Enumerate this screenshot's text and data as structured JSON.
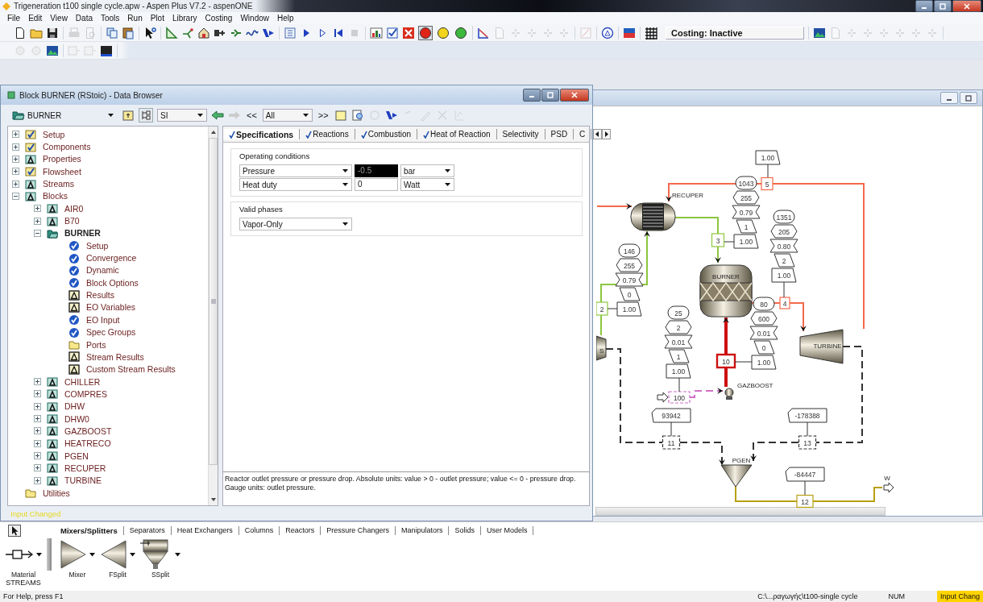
{
  "window": {
    "title": "Trigeneration t100 single cycle.apw - Aspen Plus V7.2 - aspenONE"
  },
  "menu": [
    "File",
    "Edit",
    "View",
    "Data",
    "Tools",
    "Run",
    "Plot",
    "Library",
    "Costing",
    "Window",
    "Help"
  ],
  "toolbar_1": {
    "groups": [
      [
        {
          "disabled": false
        },
        {
          "disabled": false
        },
        {
          "disabled": false
        }
      ],
      [
        {
          "disabled": true
        },
        {
          "disabled": true
        }
      ],
      [
        {
          "disabled": false
        },
        {
          "disabled": false
        }
      ],
      [
        {
          "disabled": false
        }
      ],
      [
        {
          "disabled": false
        },
        {
          "disabled": false
        },
        {
          "disabled": false
        },
        {
          "disabled": false
        },
        {
          "disabled": false
        },
        {
          "disabled": false
        },
        {
          "disabled": false
        }
      ],
      [
        {
          "disabled": false
        },
        {
          "disabled": false
        },
        {
          "disabled": false
        },
        {
          "disabled": false
        },
        {
          "disabled": true
        }
      ],
      [
        {
          "disabled": false
        },
        {
          "disabled": false
        },
        {
          "disabled": false
        }
      ],
      [
        {
          "disabled": false
        },
        {
          "disabled": true
        },
        {
          "disabled": true
        },
        {
          "disabled": true
        },
        {
          "disabled": true
        },
        {
          "disabled": true
        }
      ],
      [
        {
          "disabled": true
        }
      ],
      [
        {
          "disabled": false
        }
      ],
      [
        {
          "disabled": false
        }
      ],
      [
        {
          "disabled": false
        }
      ],
      [
        {
          "disabled": false
        },
        {
          "disabled": true
        },
        {
          "disabled": true
        },
        {
          "disabled": true
        },
        {
          "disabled": true
        },
        {
          "disabled": true
        },
        {
          "disabled": true
        },
        {
          "disabled": true
        }
      ]
    ],
    "run_lights": [
      {
        "color": "#e02418",
        "selected": true
      },
      {
        "color": "#f2d51c",
        "selected": false
      },
      {
        "color": "#3cb83c",
        "selected": false
      }
    ],
    "costing_status": "Costing: Inactive"
  },
  "toolbar_2": {
    "groups": [
      [
        {
          "disabled": true
        },
        {
          "disabled": true
        },
        {
          "disabled": false
        }
      ],
      [
        {
          "disabled": true
        },
        {
          "disabled": true
        },
        {
          "disabled": false
        }
      ]
    ]
  },
  "browser": {
    "title": "Block BURNER (RStoic) - Data Browser",
    "block_select": "BURNER",
    "units": "SI",
    "prev": "<<",
    "filter": "All",
    "next": ">>",
    "tree": [
      {
        "label": "Setup",
        "kind": "done",
        "expanded": false,
        "selected": false
      },
      {
        "label": "Components",
        "kind": "done",
        "expanded": false,
        "selected": false
      },
      {
        "label": "Properties",
        "kind": "incomplete",
        "expanded": false,
        "selected": false
      },
      {
        "label": "Flowsheet",
        "kind": "done",
        "expanded": false,
        "selected": false
      },
      {
        "label": "Streams",
        "kind": "incomplete",
        "expanded": false,
        "selected": false
      },
      {
        "label": "Blocks",
        "kind": "incomplete",
        "expanded": true,
        "selected": false,
        "children": [
          {
            "label": "AIR0",
            "kind": "incomplete",
            "expanded": false,
            "selected": false
          },
          {
            "label": "B70",
            "kind": "incomplete",
            "expanded": false,
            "selected": false
          },
          {
            "label": "BURNER",
            "kind": "open",
            "expanded": true,
            "selected": true,
            "children": [
              {
                "label": "Setup",
                "kind": "leaf",
                "selected": false
              },
              {
                "label": "Convergence",
                "kind": "leaf",
                "selected": false
              },
              {
                "label": "Dynamic",
                "kind": "leaf",
                "selected": false
              },
              {
                "label": "Block Options",
                "kind": "leaf",
                "selected": false
              },
              {
                "label": "Results",
                "kind": "results",
                "selected": false
              },
              {
                "label": "EO Variables",
                "kind": "results",
                "selected": false
              },
              {
                "label": "EO Input",
                "kind": "leaf",
                "selected": false
              },
              {
                "label": "Spec Groups",
                "kind": "leaf",
                "selected": false
              },
              {
                "label": "Ports",
                "kind": "folder",
                "selected": false
              },
              {
                "label": "Stream Results",
                "kind": "results",
                "selected": false
              },
              {
                "label": "Custom Stream Results",
                "kind": "results",
                "selected": false
              }
            ]
          },
          {
            "label": "CHILLER",
            "kind": "incomplete",
            "expanded": false,
            "selected": false
          },
          {
            "label": "COMPRES",
            "kind": "incomplete",
            "expanded": false,
            "selected": false
          },
          {
            "label": "DHW",
            "kind": "incomplete",
            "expanded": false,
            "selected": false
          },
          {
            "label": "DHW0",
            "kind": "incomplete",
            "expanded": false,
            "selected": false
          },
          {
            "label": "GAZBOOST",
            "kind": "incomplete",
            "expanded": false,
            "selected": false
          },
          {
            "label": "HEATRECO",
            "kind": "incomplete",
            "expanded": false,
            "selected": false
          },
          {
            "label": "PGEN",
            "kind": "incomplete",
            "expanded": false,
            "selected": false
          },
          {
            "label": "RECUPER",
            "kind": "incomplete",
            "expanded": false,
            "selected": false
          },
          {
            "label": "TURBINE",
            "kind": "incomplete",
            "expanded": false,
            "selected": false
          }
        ]
      },
      {
        "label": "Utilities",
        "kind": "folder",
        "selected": false
      }
    ],
    "tabs": [
      {
        "label": "Specifications",
        "complete": true,
        "selected": true
      },
      {
        "label": "Reactions",
        "complete": true,
        "selected": false
      },
      {
        "label": "Combustion",
        "complete": true,
        "selected": false
      },
      {
        "label": "Heat of Reaction",
        "complete": true,
        "selected": false
      },
      {
        "label": "Selectivity",
        "complete": false,
        "selected": false
      },
      {
        "label": "PSD",
        "complete": false,
        "selected": false
      },
      {
        "label": "C",
        "complete": false,
        "selected": false
      }
    ],
    "operating_conditions": {
      "title": "Operating conditions",
      "rows": [
        {
          "spec": "Pressure",
          "value": "-0.5",
          "unit": "bar",
          "selected": true
        },
        {
          "spec": "Heat duty",
          "value": "0",
          "unit": "Watt",
          "selected": false
        }
      ]
    },
    "valid_phases": {
      "title": "Valid phases",
      "value": "Vapor-Only"
    },
    "prompt": "Reactor outlet pressure or pressure drop. Absolute units: value > 0 - outlet pressure; value <= 0 - pressure drop. Gauge units: outlet pressure.",
    "status": "Input Changed"
  },
  "flowsheet": {
    "blocks": [
      {
        "kind": "mixer",
        "label": "S"
      },
      {
        "kind": "heat-exchanger",
        "label": "RECUPER"
      },
      {
        "kind": "reactor",
        "label": "BURNER"
      },
      {
        "kind": "turbine",
        "label": "TURBINE"
      },
      {
        "kind": "pump",
        "label": "GAZBOOST"
      },
      {
        "kind": "cone",
        "label": "PGEN"
      }
    ],
    "streams": [
      {
        "id": "5",
        "color": "#f4694a",
        "dashed": false,
        "highlighted": false
      },
      {
        "id": "3",
        "color": "#8cc63f",
        "dashed": false,
        "highlighted": false
      },
      {
        "id": "2",
        "color": "#8cc63f",
        "dashed": false,
        "highlighted": false
      },
      {
        "id": "4",
        "color": "#f4694a",
        "dashed": false,
        "highlighted": false
      },
      {
        "id": "10",
        "color": "#cc1010",
        "dashed": false,
        "highlighted": true
      },
      {
        "id": "100",
        "color": "#d070c8",
        "dashed": true,
        "highlighted": false
      },
      {
        "id": "11",
        "color": "#333333",
        "dashed": true,
        "highlighted": false
      },
      {
        "id": "13",
        "color": "#333333",
        "dashed": true,
        "highlighted": false
      },
      {
        "id": "12",
        "color": "#b8a010",
        "dashed": false,
        "highlighted": false
      },
      {
        "color": "#f4694a",
        "dashed": false,
        "highlighted": false
      }
    ],
    "tables": [
      {
        "kind": "material",
        "values": [
          "1.00"
        ]
      },
      {
        "kind": "material",
        "values": [
          "1043",
          "255",
          "0.79",
          "1",
          "1.00"
        ]
      },
      {
        "kind": "material",
        "values": [
          "1351",
          "205",
          "0.80",
          "2",
          "1.00"
        ]
      },
      {
        "kind": "material",
        "values": [
          "146",
          "255",
          "0.79",
          "0",
          "1.00"
        ]
      },
      {
        "kind": "material",
        "values": [
          "25",
          "2",
          "0.01",
          "1",
          "1.00"
        ]
      },
      {
        "kind": "material",
        "values": [
          "80",
          "600",
          "0.01",
          "0",
          "1.00"
        ]
      },
      {
        "kind": "work",
        "values": [
          "93942"
        ]
      },
      {
        "kind": "work",
        "values": [
          "-178388"
        ]
      },
      {
        "kind": "work",
        "values": [
          "-84447"
        ]
      }
    ],
    "outlet": "W"
  },
  "model_library": {
    "tabs": [
      {
        "label": "Mixers/Splitters",
        "selected": true
      },
      {
        "label": "Separators",
        "selected": false
      },
      {
        "label": "Heat Exchangers",
        "selected": false
      },
      {
        "label": "Columns",
        "selected": false
      },
      {
        "label": "Reactors",
        "selected": false
      },
      {
        "label": "Pressure Changers",
        "selected": false
      },
      {
        "label": "Manipulators",
        "selected": false
      },
      {
        "label": "Solids",
        "selected": false
      },
      {
        "label": "User Models",
        "selected": false
      }
    ],
    "models": [
      {
        "kind": "stream",
        "label": "Material",
        "group": "STREAMS"
      },
      {
        "kind": "mixer",
        "label": "Mixer"
      },
      {
        "kind": "fsplit",
        "label": "FSplit"
      },
      {
        "kind": "ssplit",
        "label": "SSplit"
      }
    ]
  },
  "status_bar": {
    "help": "For Help, press F1",
    "path": "C:\\...ραγωγής\\t100-single cycle",
    "num": "NUM",
    "state": "Input Chang"
  }
}
